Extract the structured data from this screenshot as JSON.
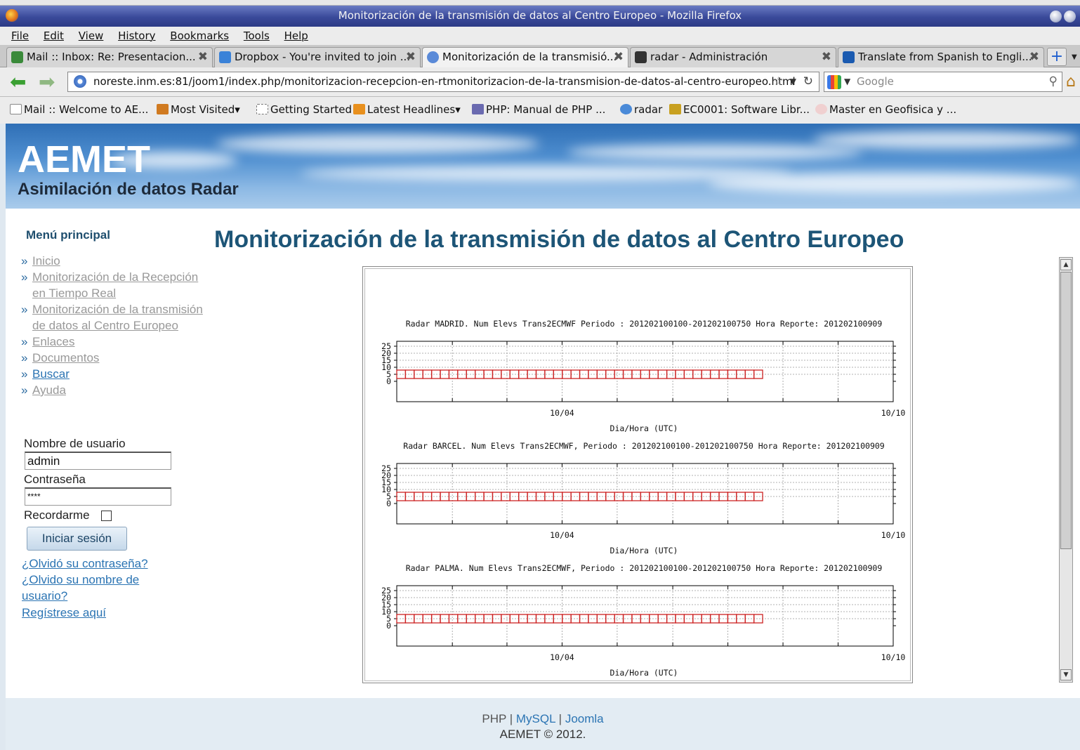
{
  "window": {
    "title": "Monitorización de la transmisión de datos al Centro Europeo - Mozilla Firefox"
  },
  "menubar": [
    "File",
    "Edit",
    "View",
    "History",
    "Bookmarks",
    "Tools",
    "Help"
  ],
  "tabs": [
    {
      "label": "Mail :: Inbox: Re: Presentacion...",
      "color": "#3a8a3a"
    },
    {
      "label": "Dropbox - You're invited to join ...",
      "color": "#3a82d8"
    },
    {
      "label": "Monitorización de la transmisió...",
      "color": "#5a8ad8"
    },
    {
      "label": "radar - Administración",
      "color": "#333333"
    },
    {
      "label": "Translate from Spanish to Engli...",
      "color": "#1a5ab0"
    }
  ],
  "nav": {
    "url": "noreste.inm.es:81/joom1/index.php/monitorizacion-recepcion-en-rtmonitorizacion-de-la-transmision-de-datos-al-centro-europeo.html",
    "search_placeholder": "Google"
  },
  "bookmarks": [
    {
      "label": "Mail :: Welcome to AE...",
      "color": "#888888"
    },
    {
      "label": "Most Visited▾",
      "color": "#d07a20"
    },
    {
      "label": "Getting Started",
      "color": "#bbbbbb"
    },
    {
      "label": "Latest Headlines▾",
      "color": "#e8901e"
    },
    {
      "label": "PHP: Manual de PHP ...",
      "color": "#6a6ab0"
    },
    {
      "label": "radar",
      "color": "#4a8ad8"
    },
    {
      "label": "EC0001: Software Libr...",
      "color": "#c8a020"
    },
    {
      "label": "Master en Geofisica y ...",
      "color": "#d86a6a"
    }
  ],
  "site": {
    "title": "AEMET",
    "subtitle": "Asimilación de datos Radar"
  },
  "sidebar": {
    "menu_title": "Menú principal",
    "items": [
      "Inicio",
      "Monitorización de la Recepción en Tiempo Real",
      "Monitorización de la transmisión de datos al Centro Europeo",
      "Enlaces",
      "Documentos",
      "Buscar",
      "Ayuda"
    ]
  },
  "login": {
    "username_label": "Nombre de usuario",
    "username_value": "admin",
    "password_label": "Contraseña",
    "password_value": "****",
    "remember_label": "Recordarme",
    "submit_label": "Iniciar sesión",
    "forgot_password": "¿Olvidó su contraseña?",
    "forgot_username_1": "¿Olvido su nombre de",
    "forgot_username_2": "usuario?",
    "register": "Regístrese aquí"
  },
  "main": {
    "title": "Monitorización de la transmisión de datos al Centro Europeo"
  },
  "chart_data": [
    {
      "type": "scatter",
      "title": "Radar MADRID. Num Elevs Trans2ECMWF  Periodo : 201202100100-201202100750 Hora Reporte: 201202100909",
      "xlabel": "Dia/Hora (UTC)",
      "x_ticks": [
        "10/04",
        "10/10"
      ],
      "y_ticks": [
        0,
        5,
        10,
        15,
        20,
        25
      ],
      "ylim": [
        0,
        25
      ],
      "xlim": [
        1,
        10.5
      ],
      "grid": true,
      "series": [
        {
          "values": [
            5,
            5,
            5,
            5,
            5,
            5,
            5,
            5,
            5,
            5,
            5,
            5,
            5,
            5,
            5,
            5,
            5,
            5,
            5,
            5,
            5,
            5,
            5,
            5,
            5,
            5,
            5,
            5,
            5,
            5,
            5,
            5,
            5,
            5,
            5,
            5,
            5,
            5,
            5,
            5,
            5,
            5
          ],
          "x_start": 1.0,
          "x_step": 0.1667,
          "color": "#cc2222"
        }
      ]
    },
    {
      "type": "scatter",
      "title": "Radar BARCEL. Num Elevs Trans2ECMWF, Periodo : 201202100100-201202100750 Hora Reporte: 201202100909",
      "xlabel": "Dia/Hora (UTC)",
      "x_ticks": [
        "10/04",
        "10/10"
      ],
      "y_ticks": [
        0,
        5,
        10,
        15,
        20,
        25
      ],
      "ylim": [
        0,
        25
      ],
      "xlim": [
        1,
        10.5
      ],
      "grid": true,
      "series": [
        {
          "values": [
            5,
            5,
            5,
            5,
            5,
            5,
            5,
            5,
            5,
            5,
            5,
            5,
            5,
            5,
            5,
            5,
            5,
            5,
            5,
            5,
            5,
            5,
            5,
            5,
            5,
            5,
            5,
            5,
            5,
            5,
            5,
            5,
            5,
            5,
            5,
            5,
            5,
            5,
            5,
            5,
            5,
            5
          ],
          "x_start": 1.0,
          "x_step": 0.1667,
          "color": "#cc2222"
        }
      ]
    },
    {
      "type": "scatter",
      "title": "Radar PALMA. Num Elevs Trans2ECMWF, Periodo : 201202100100-201202100750 Hora Reporte: 201202100909",
      "xlabel": "Dia/Hora (UTC)",
      "x_ticks": [
        "10/04",
        "10/10"
      ],
      "y_ticks": [
        0,
        5,
        10,
        15,
        20,
        25
      ],
      "ylim": [
        0,
        25
      ],
      "xlim": [
        1,
        10.5
      ],
      "grid": true,
      "series": [
        {
          "values": [
            5,
            5,
            5,
            5,
            5,
            5,
            5,
            5,
            5,
            5,
            5,
            5,
            5,
            5,
            5,
            5,
            5,
            5,
            5,
            5,
            5,
            5,
            5,
            5,
            5,
            5,
            5,
            5,
            5,
            5,
            5,
            5,
            5,
            5,
            5,
            5,
            5,
            5,
            5,
            5,
            5,
            5
          ],
          "x_start": 1.0,
          "x_step": 0.1667,
          "color": "#cc2222"
        }
      ]
    }
  ],
  "footer": {
    "php": "PHP",
    "sep": " | ",
    "mysql": "MySQL",
    "joomla": "Joomla",
    "copyright": "AEMET © 2012."
  }
}
